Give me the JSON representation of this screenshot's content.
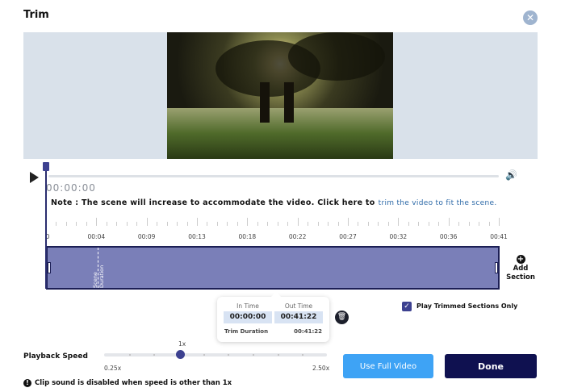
{
  "dialog": {
    "title": "Trim",
    "close_icon": "close-icon"
  },
  "player": {
    "current_time": "00:00:00",
    "note": "Note : The scene will increase to accommodate the video. Click here to",
    "note_link": "trim the video to fit the scene."
  },
  "timeline": {
    "labels": [
      "0",
      "00:04",
      "00:09",
      "00:13",
      "00:18",
      "00:22",
      "00:27",
      "00:32",
      "00:36",
      "00:41"
    ],
    "scene_label": "Scene Duration",
    "add_section": "Add Section"
  },
  "trim": {
    "in_label": "In Time",
    "out_label": "Out Time",
    "in_value": "00:00:00",
    "out_value": "00:41:22",
    "duration_label": "Trim Duration",
    "duration_value": "00:41:22"
  },
  "play_trimmed": {
    "label": "Play Trimmed Sections Only",
    "checked": true
  },
  "speed": {
    "label": "Playback Speed",
    "current": "1x",
    "min": "0.25x",
    "max": "2.50x",
    "value": 1
  },
  "buttons": {
    "use_full": "Use Full Video",
    "done": "Done"
  },
  "info": "Clip sound is disabled when speed is other than 1x",
  "colors": {
    "accent": "#3ea3f5",
    "primary": "#0f1150",
    "track": "#7a7fb8"
  }
}
